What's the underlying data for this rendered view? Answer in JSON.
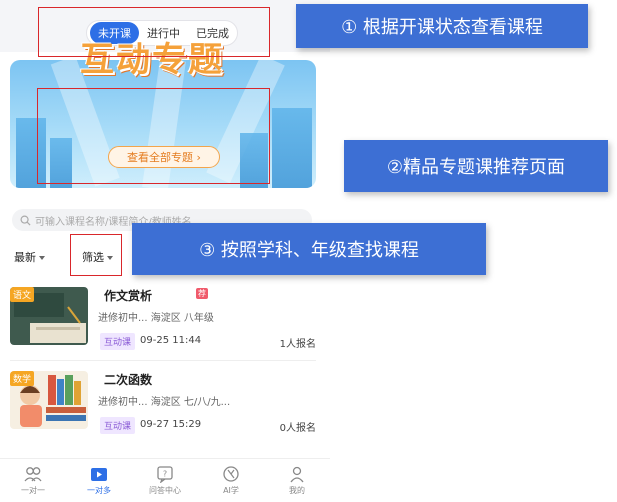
{
  "segment": {
    "tabs": [
      "未开课",
      "进行中",
      "已完成"
    ],
    "active": 0
  },
  "banner": {
    "title": "互动专题",
    "button": "查看全部专题 ›"
  },
  "search": {
    "placeholder": "可输入课程名称/课程简介/教师姓名"
  },
  "filters": {
    "sort": "最新",
    "filter": "筛选"
  },
  "callouts": [
    "① 根据开课状态查看课程",
    "②精品专题课推荐页面",
    "③ 按照学科、年级查找课程"
  ],
  "courses": [
    {
      "subject": "语文",
      "title": "作文赏析",
      "badge": "荐",
      "meta": "进修初中... 海淀区   八年级",
      "tag": "互动课",
      "date": "09-25 11:44",
      "enrolled": "1人报名"
    },
    {
      "subject": "数学",
      "title": "二次函数",
      "meta": "进修初中... 海淀区   七/八/九...",
      "tag": "互动课",
      "date": "09-27 15:29",
      "enrolled": "0人报名"
    }
  ],
  "tabbar": {
    "items": [
      "一对一",
      "一对多",
      "问答中心",
      "AI学",
      "我的"
    ],
    "icons": [
      "people-icon",
      "play-icon",
      "question-icon",
      "brain-icon",
      "person-icon"
    ],
    "active": 1
  },
  "colors": {
    "accent": "#2d6fe6",
    "callout": "#3d6fd4",
    "highlight": "#d9272b",
    "banner_title": "#f5a13a"
  }
}
